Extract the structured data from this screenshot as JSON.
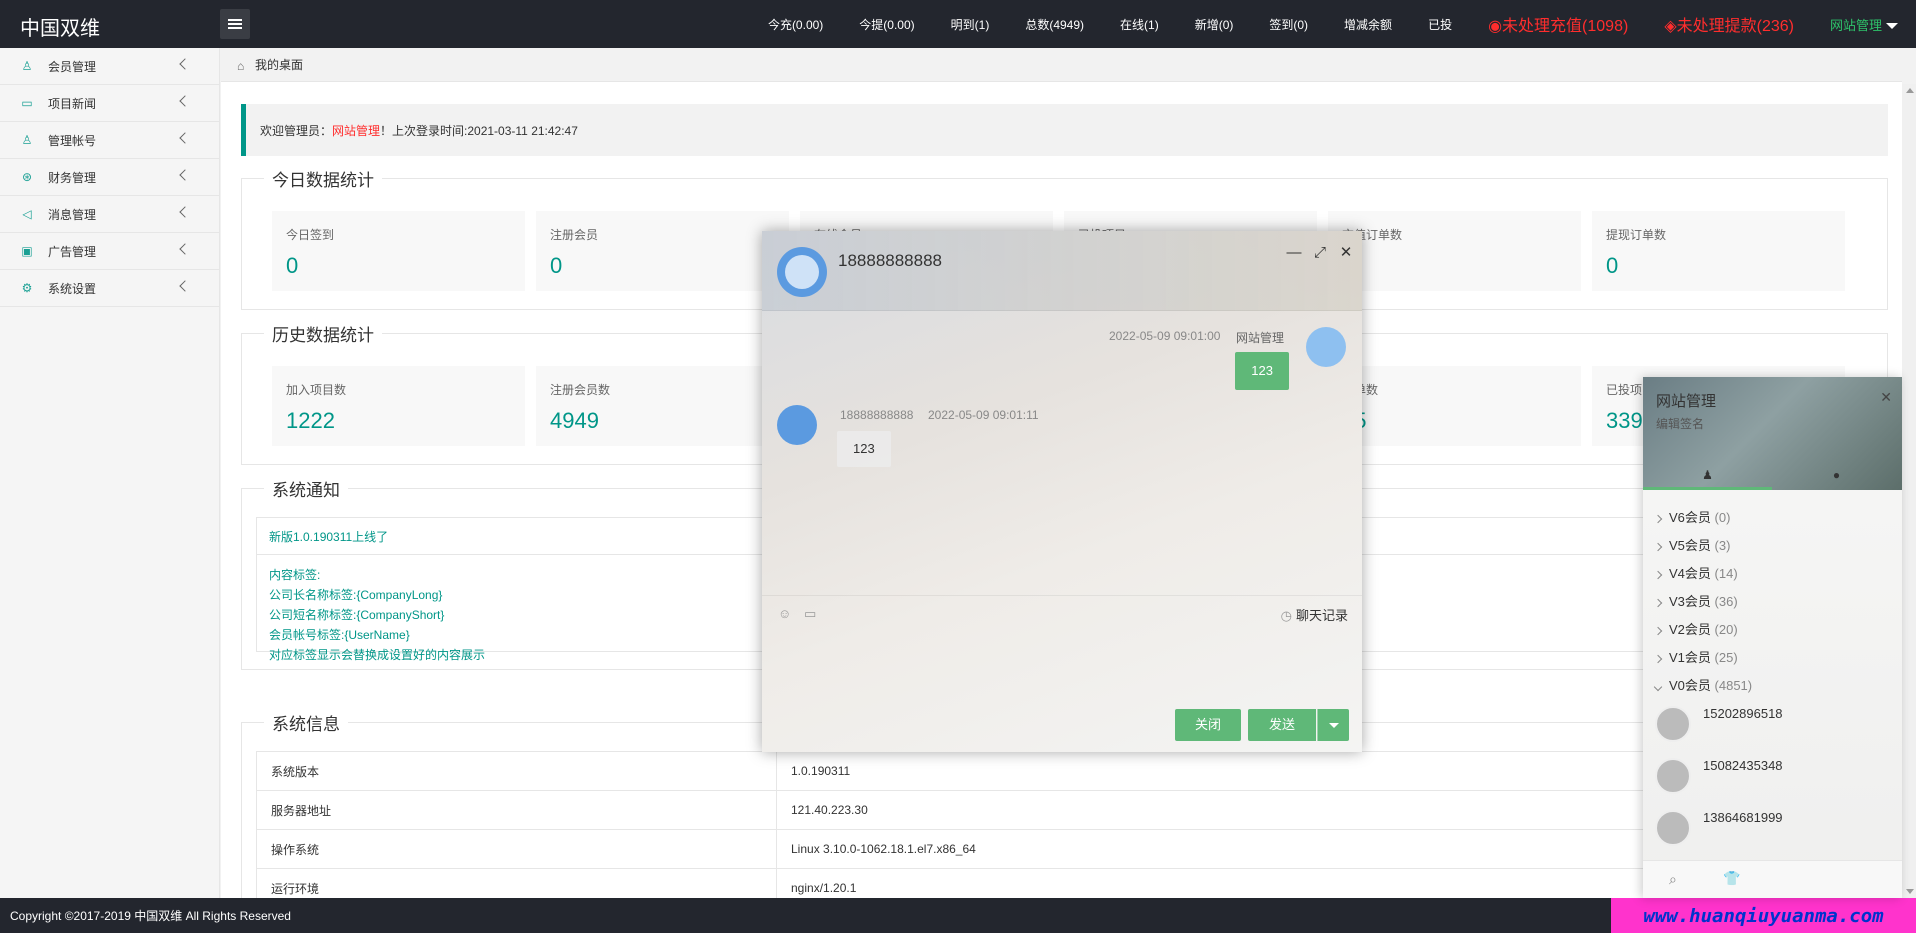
{
  "app": {
    "logo": "中国双维",
    "stats": [
      {
        "label": "今充(0.00)"
      },
      {
        "label": "今提(0.00)"
      },
      {
        "label": "明到(1)"
      },
      {
        "label": "总数(4949)"
      },
      {
        "label": "在线(1)"
      },
      {
        "label": "新增(0)"
      },
      {
        "label": "签到(0)"
      },
      {
        "label": "增减余额"
      },
      {
        "label": "已投"
      }
    ],
    "alerts": {
      "recharge": "未处理充值(1098)",
      "withdraw": "未处理提款(236)"
    },
    "user": "网站管理"
  },
  "sidebar": {
    "items": [
      {
        "label": "会员管理",
        "icon": "user-icon"
      },
      {
        "label": "项目新闻",
        "icon": "book-icon"
      },
      {
        "label": "管理帐号",
        "icon": "admin-icon"
      },
      {
        "label": "财务管理",
        "icon": "finance-icon"
      },
      {
        "label": "消息管理",
        "icon": "message-icon"
      },
      {
        "label": "广告管理",
        "icon": "ad-icon"
      },
      {
        "label": "系统设置",
        "icon": "gear-icon"
      }
    ]
  },
  "breadcrumb": "我的桌面",
  "welcome": {
    "prefix": "欢迎管理员：",
    "name": "网站管理",
    "suffix": "！上次登录时间:2021-03-11 21:42:47"
  },
  "today": {
    "title": "今日数据统计",
    "cards": [
      {
        "label": "今日签到",
        "value": "0"
      },
      {
        "label": "注册会员",
        "value": "0"
      },
      {
        "label": "在线会员",
        "value": ""
      },
      {
        "label": "已投项目",
        "value": ""
      },
      {
        "label": "充值订单数",
        "value": ""
      },
      {
        "label": "提现订单数",
        "value": "0"
      }
    ]
  },
  "history": {
    "title": "历史数据统计",
    "cards": [
      {
        "label": "加入项目数",
        "value": "1222"
      },
      {
        "label": "注册会员数",
        "value": "4949"
      },
      {
        "label": "",
        "value": ""
      },
      {
        "label": "",
        "value": ""
      },
      {
        "label": "订单数",
        "value": "05"
      },
      {
        "label": "已投项",
        "value": "339"
      }
    ]
  },
  "notice": {
    "title": "系统通知",
    "headline": "新版1.0.190311上线了",
    "lines": [
      "内容标签:",
      "公司长名称标签:{CompanyLong}",
      "公司短名称标签:{CompanyShort}",
      "会员帐号标签:{UserName}",
      "对应标签显示会替换成设置好的内容展示"
    ]
  },
  "sysinfo": {
    "title": "系统信息",
    "rows": [
      {
        "key": "系统版本",
        "value": "1.0.190311"
      },
      {
        "key": "服务器地址",
        "value": "121.40.223.30"
      },
      {
        "key": "操作系统",
        "value": "Linux 3.10.0-1062.18.1.el7.x86_64"
      },
      {
        "key": "运行环境",
        "value": "nginx/1.20.1"
      }
    ]
  },
  "footer": {
    "copyright": "Copyright ©2017-2019 中国双维 All Rights Reserved",
    "watermark": "www.huanqiuyuanma.com"
  },
  "chat": {
    "title": "18888888888",
    "messages": [
      {
        "sender": "网站管理",
        "time": "2022-05-09 09:01:00",
        "text": "123"
      },
      {
        "sender": "18888888888",
        "time": "2022-05-09 09:01:11",
        "text": "123"
      }
    ],
    "history_label": "聊天记录",
    "close_label": "关闭",
    "send_label": "发送"
  },
  "contacts": {
    "title": "网站管理",
    "subtitle": "编辑签名",
    "groups": [
      {
        "name": "V6会员",
        "count": "(0)"
      },
      {
        "name": "V5会员",
        "count": "(3)"
      },
      {
        "name": "V4会员",
        "count": "(14)"
      },
      {
        "name": "V3会员",
        "count": "(36)"
      },
      {
        "name": "V2会员",
        "count": "(20)"
      },
      {
        "name": "V1会员",
        "count": "(25)"
      },
      {
        "name": "V0会员",
        "count": "(4851)"
      }
    ],
    "members": [
      "15202896518",
      "15082435348",
      "13864681999"
    ]
  },
  "colors": {
    "accent": "#009688",
    "button_green": "#5fb878",
    "alert_red": "#ff2d2d",
    "topbar": "#23262e"
  }
}
